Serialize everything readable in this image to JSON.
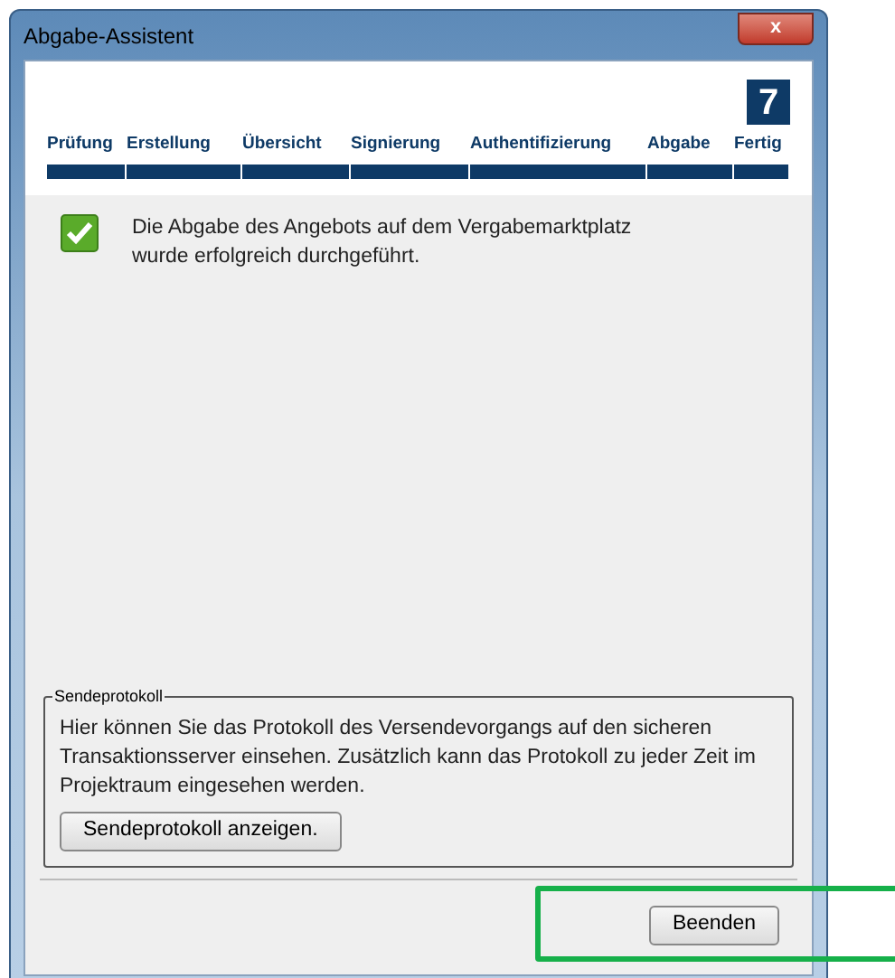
{
  "window": {
    "title": "Abgabe-Assistent",
    "close": "x"
  },
  "step_number": "7",
  "steps": [
    {
      "label": "Prüfung"
    },
    {
      "label": "Erstellung"
    },
    {
      "label": "Übersicht"
    },
    {
      "label": "Signierung"
    },
    {
      "label": "Authentifizierung"
    },
    {
      "label": "Abgabe"
    },
    {
      "label": "Fertig"
    }
  ],
  "message": "Die Abgabe des Angebots auf dem Vergabemarktplatz wurde erfolgreich durchgeführt.",
  "sendeprotokoll": {
    "legend": "Sendeprotokoll",
    "text": "Hier können Sie das Protokoll des Versendevorgangs auf den sicheren Transaktionsserver einsehen. Zusätzlich kann das Protokoll zu jeder Zeit im Projektraum eingesehen werden.",
    "button": "Sendeprotokoll anzeigen."
  },
  "buttons": [
    "Beenden"
  ]
}
